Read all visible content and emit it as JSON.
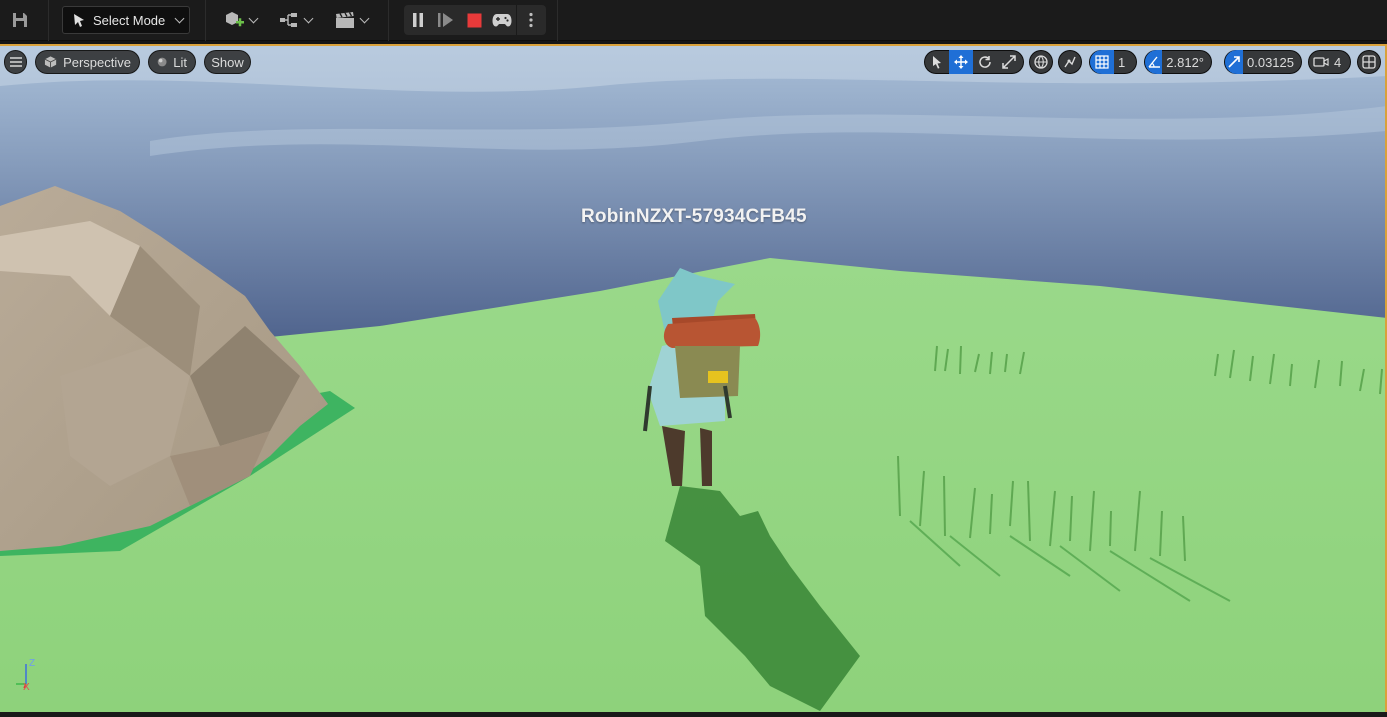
{
  "toolbar": {
    "mode_label": "Select Mode",
    "icons": [
      "save-icon",
      "add-actor-icon",
      "blueprint-icon",
      "cinematics-icon",
      "pause-icon",
      "skip-frame-icon",
      "stop-icon",
      "possess-icon",
      "more-options-icon"
    ]
  },
  "viewport": {
    "perspective_label": "Perspective",
    "lit_label": "Lit",
    "show_label": "Show",
    "grid_snap_value": "1",
    "rotation_snap_value": "2.812°",
    "scale_snap_value": "0.03125",
    "camera_speed_value": "4",
    "actor_name": "RobinNZXT-57934CFB45",
    "axis": {
      "z": "Z",
      "x": "X"
    }
  },
  "colors": {
    "accent_blue": "#1f6fd6",
    "stop_red": "#e83a3a",
    "selection_border": "#d9a13b",
    "ground": "#8fd97c"
  }
}
